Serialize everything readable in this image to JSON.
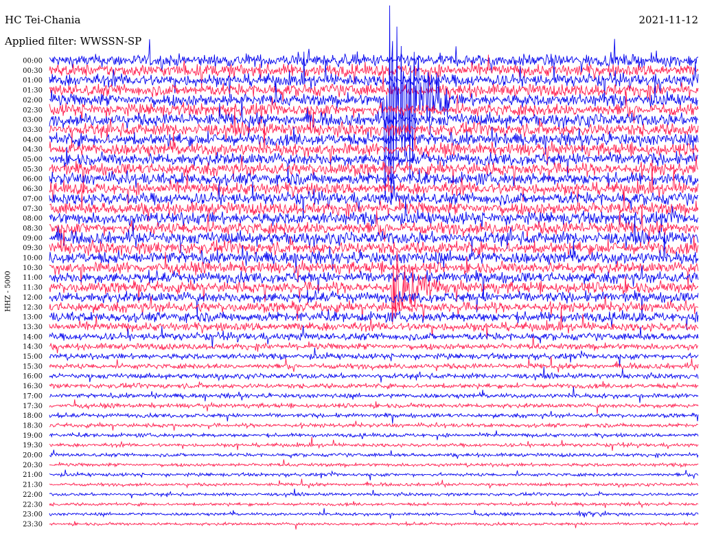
{
  "header": {
    "station": "HC Tei-Chania",
    "filter": "Applied filter: WWSSN-SP",
    "date": "2021-11-12"
  },
  "chart_data": {
    "type": "line",
    "title": "HC Tei-Chania",
    "date": "2021-11-12",
    "filter": "Applied filter: WWSSN-SP",
    "ylabel": "HHZ - 5000",
    "rows": [
      "00:00",
      "00:30",
      "01:00",
      "01:30",
      "02:00",
      "02:30",
      "03:00",
      "03:30",
      "04:00",
      "04:30",
      "05:00",
      "05:30",
      "06:00",
      "06:30",
      "07:00",
      "07:30",
      "08:00",
      "08:30",
      "09:00",
      "09:30",
      "10:00",
      "10:30",
      "11:00",
      "11:30",
      "12:00",
      "12:30",
      "13:00",
      "13:30",
      "14:00",
      "14:30",
      "15:00",
      "15:30",
      "16:00",
      "16:30",
      "17:00",
      "17:30",
      "18:00",
      "18:30",
      "19:00",
      "19:30",
      "20:00",
      "20:30",
      "21:00",
      "21:30",
      "22:00",
      "22:30",
      "23:00",
      "23:30"
    ],
    "colors": [
      "#0000ee",
      "#ff1a4b"
    ],
    "row_minutes": 30,
    "relative_noise_amplitude": [
      1.0,
      1.0,
      1.0,
      1.0,
      1.0,
      1.0,
      1.0,
      1.0,
      1.0,
      1.0,
      1.0,
      1.0,
      1.0,
      1.0,
      1.0,
      1.0,
      1.0,
      1.0,
      1.0,
      1.0,
      1.0,
      0.9,
      0.9,
      0.9,
      0.85,
      0.8,
      0.8,
      0.7,
      0.6,
      0.5,
      0.45,
      0.42,
      0.4,
      0.38,
      0.36,
      0.35,
      0.33,
      0.32,
      0.3,
      0.29,
      0.28,
      0.27,
      0.26,
      0.25,
      0.24,
      0.24,
      0.23,
      0.23
    ],
    "events": [
      {
        "row": "02:00",
        "minute": 15.5,
        "amplitude": 5.0
      },
      {
        "row": "11:30",
        "minute": 15.8,
        "amplitude": 1.5
      },
      {
        "row": "23:00",
        "minute": 24.5,
        "amplitude": 0.5
      }
    ]
  }
}
